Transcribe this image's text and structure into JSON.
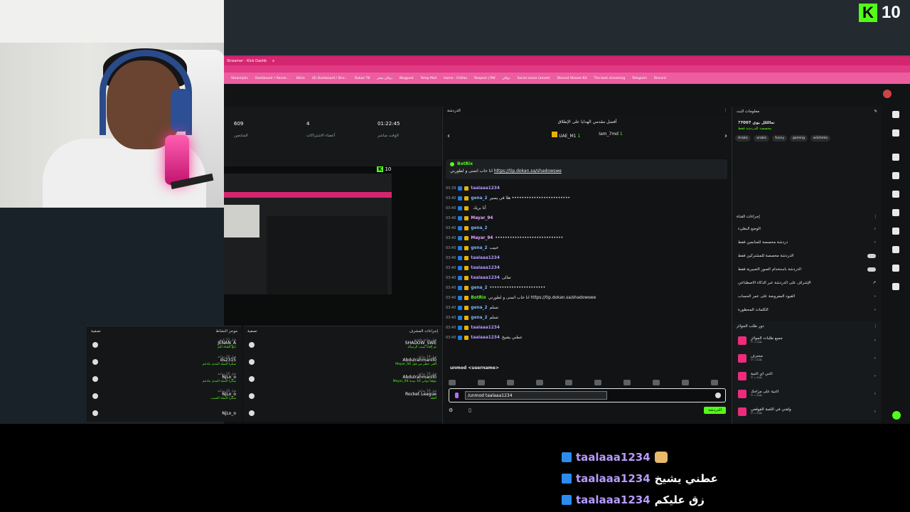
{
  "kick_badge": {
    "logo": "K",
    "count": "10"
  },
  "bookmarks": [
    "Steamlytic",
    "Dashboard • Revier...",
    "Bitrix",
    "(6) Dashboard / Stre...",
    "Dokan T8",
    "دوكان متجر",
    "Blogpost",
    "Temp Mail",
    "Home - Chillax",
    "Respect | PW",
    "دوكان",
    "Social scene (annet)",
    "Discord Stream Kit",
    "The best streaming",
    "Telegram",
    "Discord"
  ],
  "stats": [
    {
      "value": "609",
      "label": "المتابعين"
    },
    {
      "value": "4",
      "label": "أعضاء الاشتراكات"
    },
    {
      "value": "01:22:45",
      "label": "الوقت مباشر"
    }
  ],
  "preview": {
    "kick": "K",
    "count": "10"
  },
  "activity": {
    "title": "موجز النشاط",
    "filter": "تصفية",
    "items": [
      {
        "name": "JENAN_A",
        "desc": "تابع القناة لكم",
        "time": "قبل 52 ثانية"
      },
      {
        "name": "ds2315",
        "desc": "شكرا الصلة المدى مادعم",
        "time": "قبل 20 ساعة"
      },
      {
        "name": "NjLo_o",
        "desc": "شكرا الصلة المدى مادعم",
        "time": "قبل 20 ساعة"
      },
      {
        "name": "NjLo_o",
        "desc": "شكرا الصلة الحبيب",
        "time": "قبل 20 ساعة"
      },
      {
        "name": "NjLo_o",
        "desc": "",
        "time": ""
      }
    ]
  },
  "moderation": {
    "title": "إجراءات المشرف",
    "filter": "تصفية",
    "items": [
      {
        "name": "SHADOW_SWE",
        "desc": "تم إلغاء تثبيت الرسالة",
        "time": "قبل ساعة واحدة"
      },
      {
        "name": "Abdulrahmanll0",
        "desc": "ألغى حظر من قبل Mayar_94",
        "time": "قبل 19 ساعة"
      },
      {
        "name": "Abdulrahmanll0",
        "desc": "مؤقتاً ثواني 10 بمدة Mayar_94",
        "time": "قبل 19 ساعة"
      },
      {
        "name": "Rocket League",
        "desc": "الفئة",
        "time": "قبل 19 ساعة"
      },
      {
        "name": "",
        "desc": "",
        "time": ""
      }
    ]
  },
  "chat": {
    "title": "الدردشة",
    "gift_title": "أفضل مقدمي الهدايا على الإطلاق",
    "gifters": [
      {
        "name": "UAE_M1",
        "count": "1"
      },
      {
        "name": "Iam_7md",
        "count": "1"
      }
    ],
    "pinned": {
      "by": "BotRix",
      "text": "انا حاب اتمنى و لطورني",
      "link": "https://tip.dokan.sa/shadowswe"
    },
    "messages": [
      {
        "time": "03:39",
        "user": "taalaaa1234",
        "color": "#b79bff",
        "text": ""
      },
      {
        "time": "03:40",
        "user": "gena_2",
        "color": "#7fb6ff",
        "text": "هلا في يسير ••••••••••••••••••••••••"
      },
      {
        "time": "03:40",
        "user": "",
        "color": "#b79bff",
        "text": "أنا بريك"
      },
      {
        "time": "03:40",
        "user": "Mayar_94",
        "color": "#e6a6ff",
        "text": ""
      },
      {
        "time": "03:40",
        "user": "gena_2",
        "color": "#7fb6ff",
        "text": ""
      },
      {
        "time": "03:40",
        "user": "Mayar_94",
        "color": "#e6a6ff",
        "text": "••••••••••••••••••••••••••••"
      },
      {
        "time": "03:40",
        "user": "gena_2",
        "color": "#7fb6ff",
        "text": "حبيب"
      },
      {
        "time": "03:40",
        "user": "taalaaa1234",
        "color": "#b79bff",
        "text": ""
      },
      {
        "time": "03:40",
        "user": "taalaaa1234",
        "color": "#b79bff",
        "text": ""
      },
      {
        "time": "03:40",
        "user": "taalaaa1234",
        "color": "#b79bff",
        "text": "تعالى"
      },
      {
        "time": "03:40",
        "user": "gena_2",
        "color": "#7fb6ff",
        "text": "•••••••••••••••••••••••"
      },
      {
        "time": "03:40",
        "user": "BotRix",
        "color": "#53fc18",
        "text": "انا حاب اتمنى و لطورني https://tip.dokan.sa/shadowswe"
      },
      {
        "time": "03:40",
        "user": "gena_2",
        "color": "#7fb6ff",
        "text": "تسلم"
      },
      {
        "time": "03:40",
        "user": "gena_2",
        "color": "#7fb6ff",
        "text": "تسلم"
      },
      {
        "time": "03:40",
        "user": "taalaaa1234",
        "color": "#b79bff",
        "text": ""
      },
      {
        "time": "03:40",
        "user": "taalaaa1234",
        "color": "#b79bff",
        "text": "عطني يشيخ"
      }
    ],
    "command_hint": "unmod <username>",
    "input_value": "/unmod taalaaa1234",
    "send_label": "الدردشة"
  },
  "channel_info": {
    "title": "معلومات البث",
    "stream_title": "?7007 تعالللل يوي",
    "category": "مخصصة للدردشة فقط",
    "tags": [
      "Arabic",
      "arabic",
      "funny",
      "gaming",
      "w3shmlo"
    ]
  },
  "channel_actions": {
    "title": "إجراءات القناة",
    "items": [
      {
        "label": "الوضع البطيء",
        "type": "arrow"
      },
      {
        "label": "دردشة مخصصة للمتابعين فقط",
        "type": "arrow"
      },
      {
        "label": "الدردشة مخصصة للمشتركين فقط",
        "type": "toggle"
      },
      {
        "label": "الدردشة باستخدام الصور التعبيرية فقط",
        "type": "toggle"
      },
      {
        "label": "الإشراف على الدردشة عبر الذكاء الاصطناعي",
        "type": "link"
      },
      {
        "label": "القيود المفروضة على عمر الحساب",
        "type": "arrow"
      },
      {
        "label": "الكلمات المحظورة",
        "type": "arrow"
      }
    ]
  },
  "rewards": {
    "title": "دور طلب الجوائز",
    "items": [
      {
        "label": "جميع طلبات الجوائز",
        "sub": "طلبات 0"
      },
      {
        "label": "محترف",
        "sub": "طلبات 0"
      },
      {
        "label": "اغني اي اغنية",
        "sub": "طلبات 0"
      },
      {
        "label": "اغنية على مزاجك",
        "sub": "طلبات 0"
      },
      {
        "label": "ولقني في اللعبة القوقعي",
        "sub": "طلبات 0"
      }
    ]
  },
  "overlay_chat": [
    {
      "user": "taalaaa1234",
      "text": ""
    },
    {
      "user": "taalaaa1234",
      "text": "عطني يشيخ"
    },
    {
      "user": "taalaaa1234",
      "text": "زق عليكم"
    }
  ]
}
